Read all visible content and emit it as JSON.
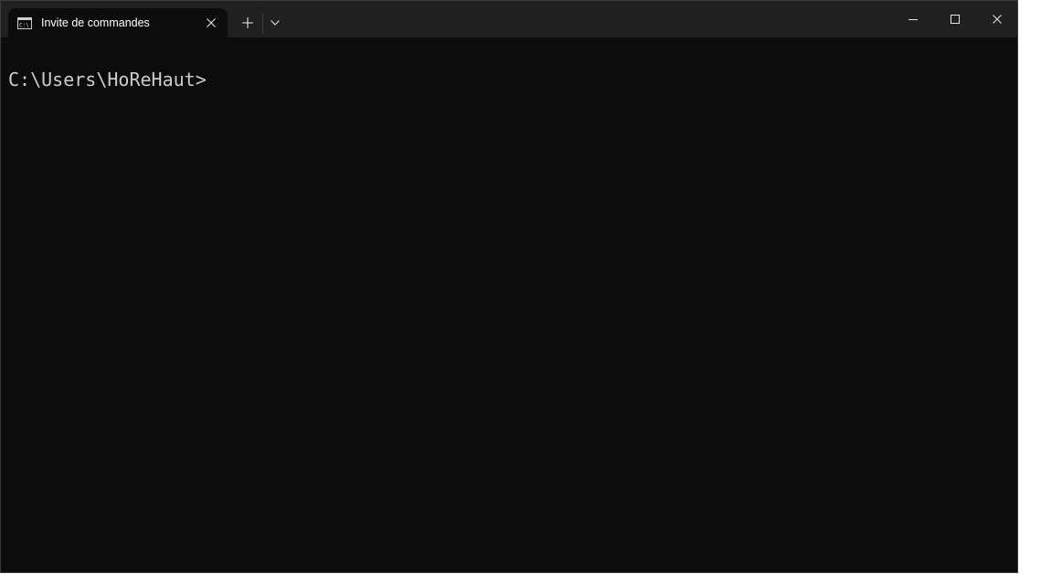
{
  "window": {
    "tab_title": "Invite de commandes",
    "icons": {
      "tab": "cmd-icon",
      "tab_close": "close-icon",
      "new_tab": "plus-icon",
      "dropdown": "chevron-down-icon",
      "minimize": "minimize-icon",
      "maximize": "maximize-icon",
      "close": "close-icon"
    }
  },
  "terminal": {
    "prompt": "C:\\Users\\HoReHaut>"
  },
  "colors": {
    "titlebar": "#202020",
    "terminal_bg": "#0c0c0c",
    "text": "#cccccc"
  }
}
